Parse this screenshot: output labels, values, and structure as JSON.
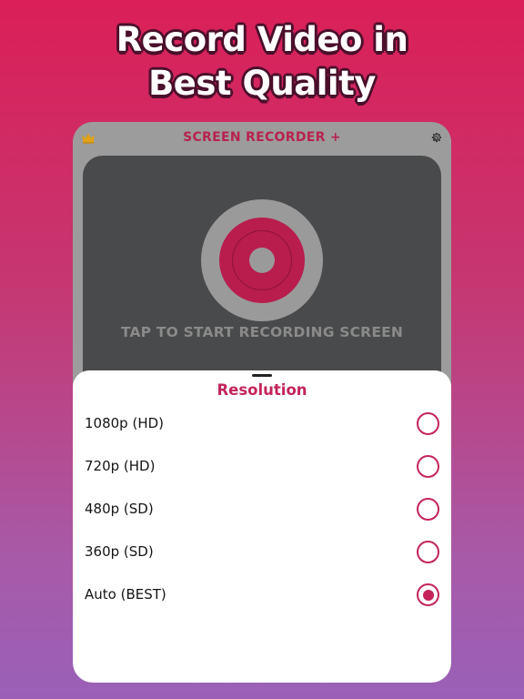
{
  "headline": {
    "line1": "Record Video in",
    "line2": "Best Quality"
  },
  "app": {
    "title": "SCREEN RECORDER +",
    "record_hint": "TAP TO START RECORDING SCREEN",
    "icons": {
      "left": "crown-icon",
      "right": "gear-icon"
    }
  },
  "sheet": {
    "title": "Resolution",
    "options": [
      {
        "label": "1080p (HD)",
        "selected": false
      },
      {
        "label": "720p (HD)",
        "selected": false
      },
      {
        "label": "480p (SD)",
        "selected": false
      },
      {
        "label": "360p (SD)",
        "selected": false
      },
      {
        "label": "Auto (BEST)",
        "selected": true
      }
    ]
  },
  "colors": {
    "accent": "#c4245a",
    "title": "#b8224e",
    "panel": "#494a4b",
    "crown": "#e0a21a"
  }
}
